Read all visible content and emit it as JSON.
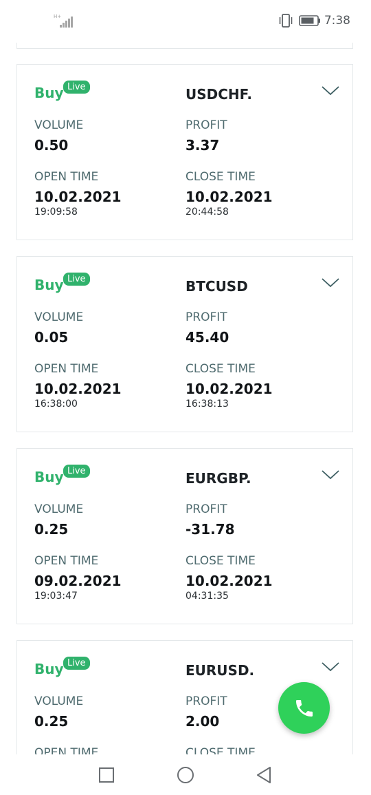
{
  "status_bar": {
    "network": "H+",
    "time": "7:38",
    "icons": [
      "signal-icon",
      "vibrate-icon",
      "battery-icon"
    ]
  },
  "labels": {
    "volume": "VOLUME",
    "profit": "PROFIT",
    "open_time": "OPEN TIME",
    "close_time": "CLOSE TIME"
  },
  "trades": [
    {
      "side": "Buy",
      "badge": "Live",
      "symbol": "USDCHF.",
      "volume": "0.50",
      "profit": "3.37",
      "open_date": "10.02.2021",
      "open_time": "19:09:58",
      "close_date": "10.02.2021",
      "close_time": "20:44:58"
    },
    {
      "side": "Buy",
      "badge": "Live",
      "symbol": "BTCUSD",
      "volume": "0.05",
      "profit": "45.40",
      "open_date": "10.02.2021",
      "open_time": "16:38:00",
      "close_date": "10.02.2021",
      "close_time": "16:38:13"
    },
    {
      "side": "Buy",
      "badge": "Live",
      "symbol": "EURGBP.",
      "volume": "0.25",
      "profit": "-31.78",
      "open_date": "09.02.2021",
      "open_time": "19:03:47",
      "close_date": "10.02.2021",
      "close_time": "04:31:35"
    },
    {
      "side": "Buy",
      "badge": "Live",
      "symbol": "EURUSD.",
      "volume": "0.25",
      "profit": "2.00",
      "open_date": "",
      "open_time": "",
      "close_date": "",
      "close_time": ""
    }
  ],
  "fab": {
    "icon": "phone-icon"
  },
  "nav_bar": {
    "icons": [
      "recent-apps-icon",
      "home-icon",
      "back-icon"
    ]
  },
  "colors": {
    "accent": "#30b26c",
    "fab": "#2fd15a",
    "label": "#4f6b6f",
    "value": "#111417",
    "border": "#e4e8ea"
  }
}
